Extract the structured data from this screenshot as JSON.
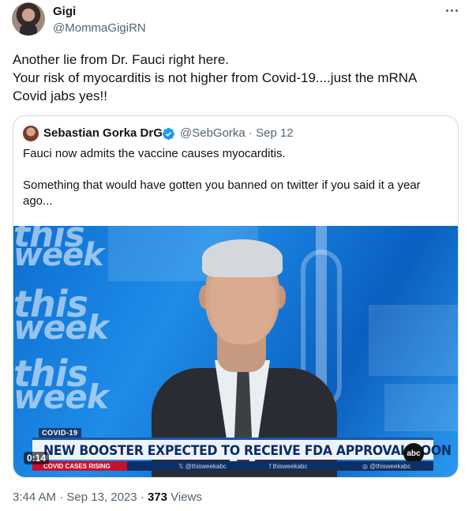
{
  "author": {
    "name": "Gigi",
    "handle": "@MommaGigiRN"
  },
  "tweet": {
    "lines": [
      "Another lie from Dr. Fauci right here.",
      "Your risk of myocarditis is not higher from Covid-19....just the mRNA",
      "Covid jabs yes!!"
    ]
  },
  "quote": {
    "name": "Sebastian Gorka DrG",
    "handle_date": "@SebGorka · Sep 12",
    "text_1": "Fauci now admits the vaccine causes myocarditis.",
    "text_2": "Something that would have gotten you banned on twitter if you said it a year ago...",
    "media": {
      "bg_words": [
        "this",
        "week",
        "this",
        "week",
        "this",
        "week"
      ],
      "covid_tag": "COVID-19",
      "headline": "NEW BOOSTER EXPECTED TO RECEIVE FDA APPROVAL SOON",
      "logo": "abc",
      "ticker_left": "COVID CASES RISING",
      "ticker_1": "𝕏 @thisweekabc",
      "ticker_2": "f thisweekabc",
      "ticker_3": "◎ @thisweekabc",
      "duration": "0:14"
    }
  },
  "meta": {
    "time_date": "3:44 AM · Sep 13, 2023 · ",
    "views_count": "373",
    "views_label": " Views"
  },
  "colors": {
    "text_primary": "#0f1419",
    "text_secondary": "#536471",
    "border": "#cfd9de",
    "verified": "#1d9bf0",
    "media_blue": "#1f8ce8"
  },
  "icons": [
    "more-icon",
    "verified-icon"
  ]
}
